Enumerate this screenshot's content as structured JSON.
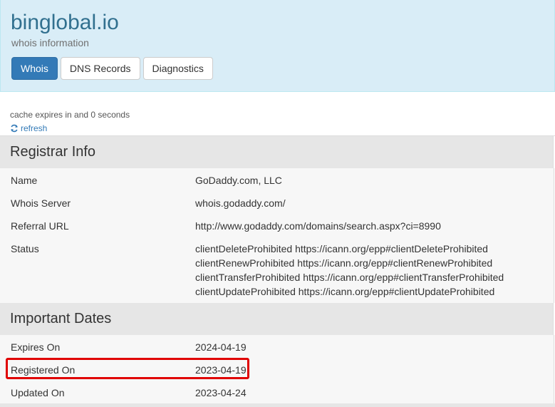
{
  "header": {
    "domain": "binglobal.io",
    "subtitle": "whois information",
    "tabs": [
      {
        "label": "Whois",
        "active": true
      },
      {
        "label": "DNS Records",
        "active": false
      },
      {
        "label": "Diagnostics",
        "active": false
      }
    ]
  },
  "cache": {
    "text": "cache expires in and 0 seconds",
    "refresh_label": "refresh",
    "refresh_icon": "refresh-icon"
  },
  "registrar": {
    "heading": "Registrar Info",
    "name_label": "Name",
    "name_value": "GoDaddy.com, LLC",
    "whois_server_label": "Whois Server",
    "whois_server_value": "whois.godaddy.com/",
    "referral_label": "Referral URL",
    "referral_value": "http://www.godaddy.com/domains/search.aspx?ci=8990",
    "status_label": "Status",
    "status_values": [
      "clientDeleteProhibited https://icann.org/epp#clientDeleteProhibited",
      "clientRenewProhibited https://icann.org/epp#clientRenewProhibited",
      "clientTransferProhibited https://icann.org/epp#clientTransferProhibited",
      "clientUpdateProhibited https://icann.org/epp#clientUpdateProhibited"
    ]
  },
  "dates": {
    "heading": "Important Dates",
    "expires_label": "Expires On",
    "expires_value": "2024-04-19",
    "registered_label": "Registered On",
    "registered_value": "2023-04-19",
    "updated_label": "Updated On",
    "updated_value": "2023-04-24"
  },
  "colors": {
    "header_bg": "#d9edf7",
    "title": "#31708f",
    "active_tab": "#337ab7",
    "highlight": "#e00000"
  }
}
